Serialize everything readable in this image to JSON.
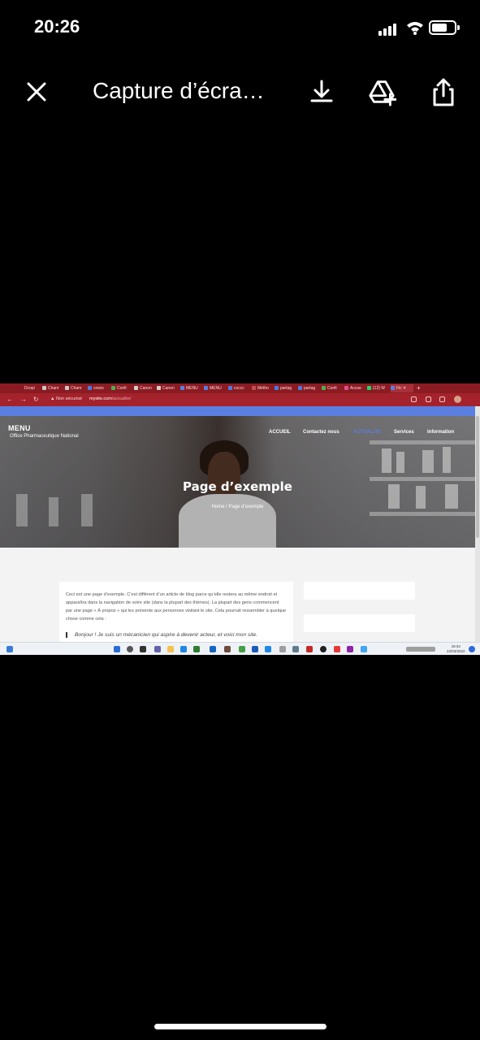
{
  "status_bar": {
    "time": "20:26"
  },
  "viewer": {
    "title": "Capture d’écra…"
  },
  "screenshot": {
    "tabs": [
      "Dcopi",
      "Chanr",
      "Chanr",
      "crwoc",
      "Confi",
      "Canon",
      "Canon",
      "MENU",
      "MENU",
      "coccc",
      "Métho",
      "partag",
      "partag",
      "Confi",
      "Accue",
      "(12) W",
      "Fic"
    ],
    "address": {
      "security": "Non sécurisé",
      "host": "mysite.com",
      "path": "/actualite/"
    },
    "site": {
      "brand": "MENU",
      "subtitle": "Office Pharmaceutique National",
      "menu": [
        "ACCUEIL",
        "Contactez nous",
        "ACTUALITE",
        "Services",
        "Information"
      ],
      "page_title": "Page d’exemple",
      "breadcrumb": "Home /  Page d’exemple",
      "body": "Ceci est une page d’exemple. C’est différent d’un article de blog parce qu’elle restera au même endroit et apparaîtra dans la navigation de votre site (dans la plupart des thèmes). La plupart des gens commencent par une page « À propos » qui les présente aux personnes visitant le site. Cela pourrait ressembler à quelque chose comme cela :",
      "quote": "Bonjour ! Je suis un mécanicien qui aspire à devenir acteur, et voici mon site."
    },
    "taskbar": {
      "time": "16:34",
      "date": "22/03/2022"
    }
  },
  "colors": {
    "browser_tab": "#8b1b22",
    "accent": "#5b7fe0"
  }
}
